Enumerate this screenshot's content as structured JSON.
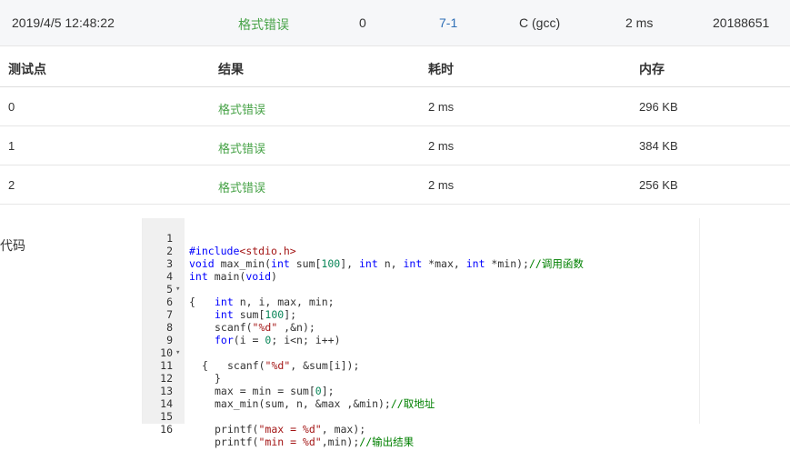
{
  "summary": {
    "datetime": "2019/4/5 12:48:22",
    "status": "格式错误",
    "score": "0",
    "problem": "7-1",
    "compiler": "C (gcc)",
    "time": "2 ms",
    "user": "20188651"
  },
  "table": {
    "headers": [
      "测试点",
      "结果",
      "耗时",
      "内存"
    ],
    "rows": [
      {
        "point": "0",
        "result": "格式错误",
        "time": "2 ms",
        "memory": "296 KB"
      },
      {
        "point": "1",
        "result": "格式错误",
        "time": "2 ms",
        "memory": "384 KB"
      },
      {
        "point": "2",
        "result": "格式错误",
        "time": "2 ms",
        "memory": "256 KB"
      }
    ]
  },
  "code_label": "代码",
  "code": {
    "line_numbers": [
      "1",
      "2",
      "3",
      "4",
      "5",
      "6",
      "7",
      "8",
      "9",
      "10",
      "11",
      "12",
      "13",
      "14",
      "15",
      "16"
    ],
    "l1a": "#include",
    "l1b": "<stdio.h>",
    "l2": [
      "void",
      " max_min(",
      "int",
      " sum[",
      "100",
      "], ",
      "int",
      " n, ",
      "int",
      " *max, ",
      "int",
      " *min);",
      "//调用函数"
    ],
    "l3": [
      "int",
      " main(",
      "void",
      ")"
    ],
    "l4": "{",
    "l5": [
      "int",
      " n, i, max, min;"
    ],
    "l6": [
      "int",
      " sum[",
      "100",
      "];"
    ],
    "l7": [
      "scanf(",
      "\"%d\"",
      " ,&n);"
    ],
    "l8": [
      "for",
      "(i = ",
      "0",
      "; i<n; i++)"
    ],
    "l9": "{",
    "l10": [
      "scanf(",
      "\"%d\"",
      ", &sum[i]);"
    ],
    "l11": "}",
    "l12": [
      "max = min = sum[",
      "0",
      "];"
    ],
    "l13": [
      "max_min(sum, n, &max ,&min);",
      "//取地址"
    ],
    "l14": "",
    "l15": [
      "printf(",
      "\"max = %d\"",
      ", max);"
    ],
    "l16": [
      "printf(",
      "\"min = %d\"",
      ",min);",
      "//输出结果"
    ],
    "fold_icon": "▾"
  }
}
